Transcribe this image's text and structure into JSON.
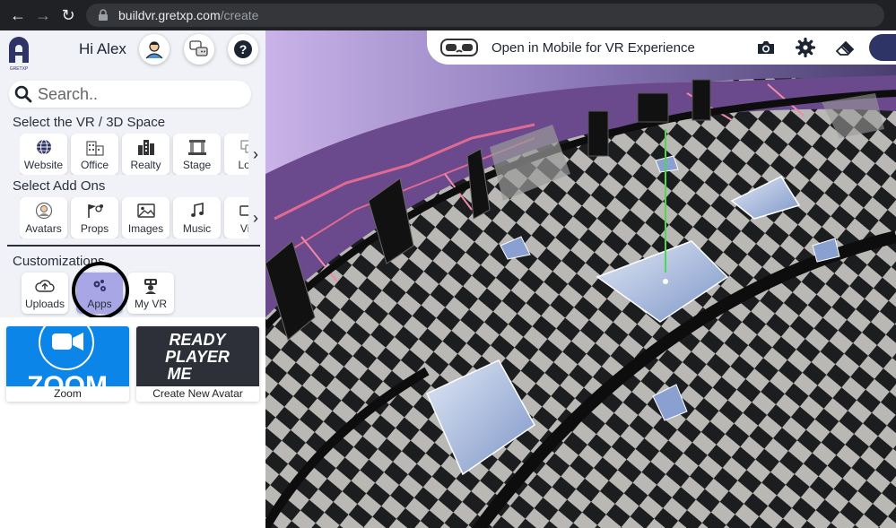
{
  "browser": {
    "url_host": "buildvr.gretxp.com",
    "url_path": "/create"
  },
  "sidebar": {
    "logo_text": "GRETXP",
    "greeting": "Hi Alex",
    "search_placeholder": "Search..",
    "space_section": {
      "title": "Select the VR / 3D Space",
      "items": [
        {
          "label": "Website",
          "icon": "globe-icon"
        },
        {
          "label": "Office",
          "icon": "office-building-icon"
        },
        {
          "label": "Realty",
          "icon": "city-buildings-icon"
        },
        {
          "label": "Stage",
          "icon": "stage-icon"
        },
        {
          "label": "Low",
          "icon": "low-poly-icon"
        }
      ]
    },
    "addons_section": {
      "title": "Select Add Ons",
      "items": [
        {
          "label": "Avatars",
          "icon": "avatar-icon"
        },
        {
          "label": "Props",
          "icon": "props-icon"
        },
        {
          "label": "Images",
          "icon": "image-icon"
        },
        {
          "label": "Music",
          "icon": "music-note-icon"
        },
        {
          "label": "Vid",
          "icon": "video-icon"
        }
      ]
    },
    "customizations": {
      "title": "Customizations",
      "items": [
        {
          "label": "Uploads",
          "icon": "cloud-upload-icon"
        },
        {
          "label": "Apps",
          "icon": "gears-icon",
          "active": true
        },
        {
          "label": "My VR",
          "icon": "vr-avatar-icon"
        }
      ]
    },
    "apps": [
      {
        "label": "Zoom",
        "logo_text": "ZOOM"
      },
      {
        "label": "Create New Avatar",
        "logo_lines": [
          "READY",
          "PLAYER",
          "ME"
        ]
      }
    ]
  },
  "viewport": {
    "vr_prompt": "Open in Mobile for VR Experience",
    "tools": [
      "camera-icon",
      "gear-icon",
      "eraser-icon"
    ]
  },
  "colors": {
    "accent": "#2f3466",
    "active_tile": "#a9a6e6",
    "zoom_blue": "#0b86e8"
  }
}
